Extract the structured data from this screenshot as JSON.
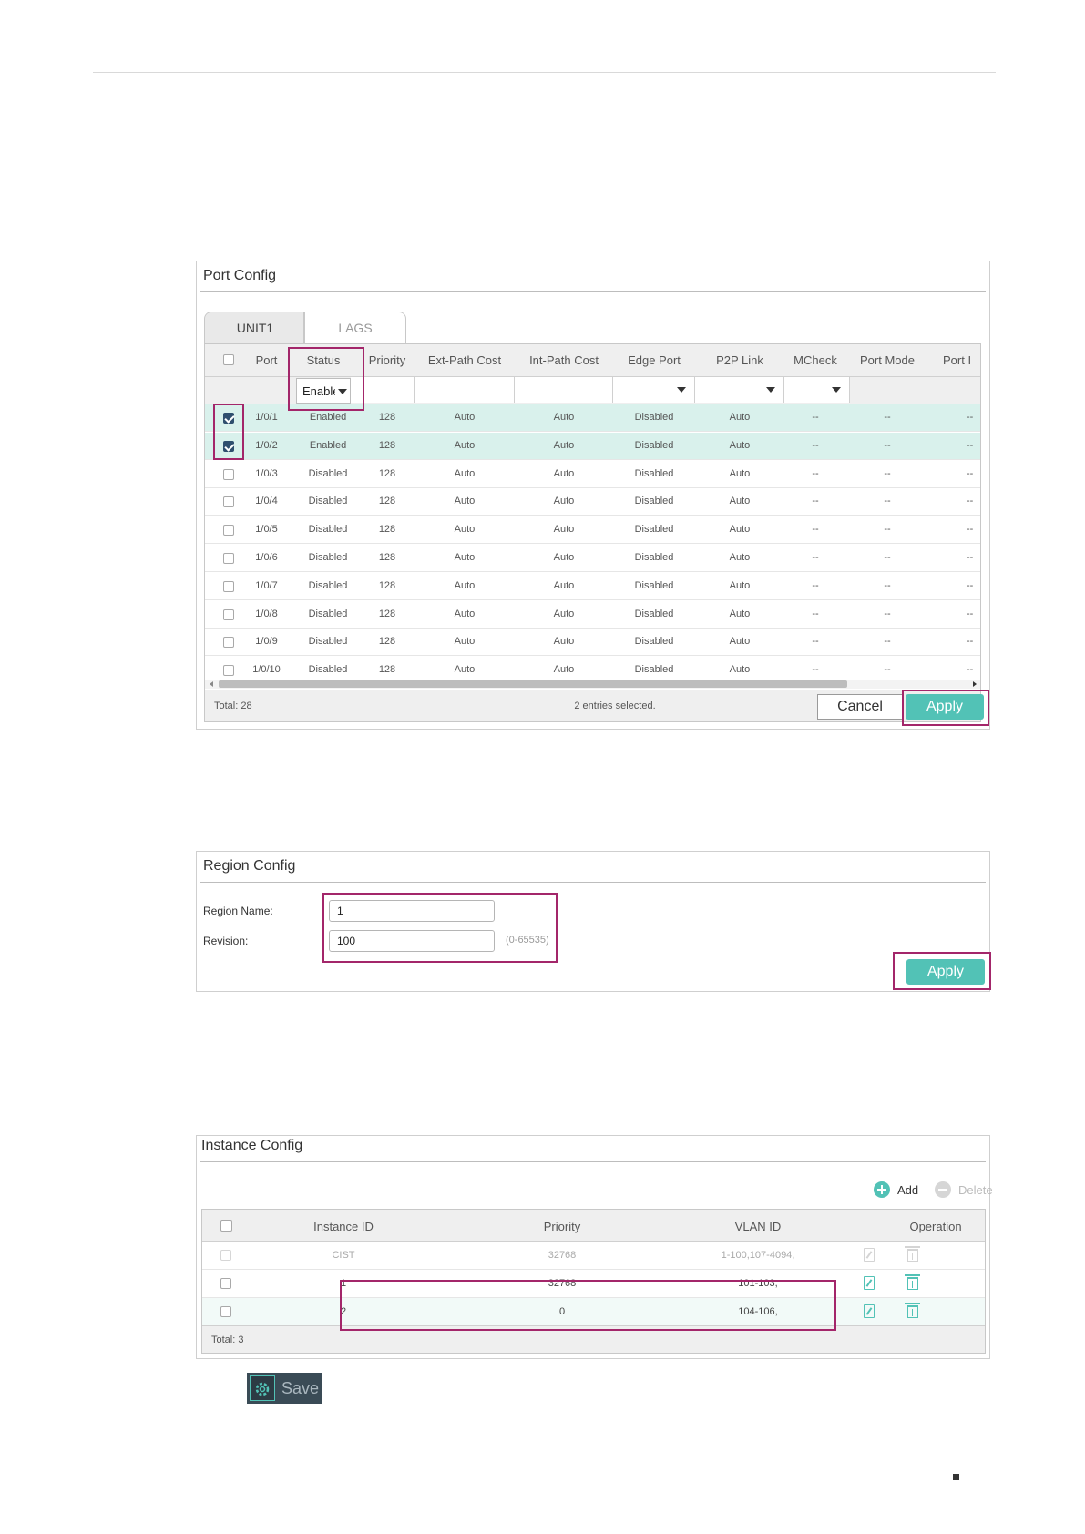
{
  "port_config": {
    "title": "Port Config",
    "tabs": [
      {
        "label": "UNIT1"
      },
      {
        "label": "LAGS"
      }
    ],
    "columns": [
      "Port",
      "Status",
      "Priority",
      "Ext-Path Cost",
      "Int-Path Cost",
      "Edge Port",
      "P2P Link",
      "MCheck",
      "Port Mode",
      "Port I"
    ],
    "filter_status_value": "Enable",
    "rows": [
      {
        "port": "1/0/1",
        "status": "Enabled",
        "priority": "128",
        "ext": "Auto",
        "int": "Auto",
        "edge": "Disabled",
        "p2p": "Auto",
        "mcheck": "--",
        "mode": "--",
        "role": "--",
        "checked": true
      },
      {
        "port": "1/0/2",
        "status": "Enabled",
        "priority": "128",
        "ext": "Auto",
        "int": "Auto",
        "edge": "Disabled",
        "p2p": "Auto",
        "mcheck": "--",
        "mode": "--",
        "role": "--",
        "checked": true
      },
      {
        "port": "1/0/3",
        "status": "Disabled",
        "priority": "128",
        "ext": "Auto",
        "int": "Auto",
        "edge": "Disabled",
        "p2p": "Auto",
        "mcheck": "--",
        "mode": "--",
        "role": "--",
        "checked": false
      },
      {
        "port": "1/0/4",
        "status": "Disabled",
        "priority": "128",
        "ext": "Auto",
        "int": "Auto",
        "edge": "Disabled",
        "p2p": "Auto",
        "mcheck": "--",
        "mode": "--",
        "role": "--",
        "checked": false
      },
      {
        "port": "1/0/5",
        "status": "Disabled",
        "priority": "128",
        "ext": "Auto",
        "int": "Auto",
        "edge": "Disabled",
        "p2p": "Auto",
        "mcheck": "--",
        "mode": "--",
        "role": "--",
        "checked": false
      },
      {
        "port": "1/0/6",
        "status": "Disabled",
        "priority": "128",
        "ext": "Auto",
        "int": "Auto",
        "edge": "Disabled",
        "p2p": "Auto",
        "mcheck": "--",
        "mode": "--",
        "role": "--",
        "checked": false
      },
      {
        "port": "1/0/7",
        "status": "Disabled",
        "priority": "128",
        "ext": "Auto",
        "int": "Auto",
        "edge": "Disabled",
        "p2p": "Auto",
        "mcheck": "--",
        "mode": "--",
        "role": "--",
        "checked": false
      },
      {
        "port": "1/0/8",
        "status": "Disabled",
        "priority": "128",
        "ext": "Auto",
        "int": "Auto",
        "edge": "Disabled",
        "p2p": "Auto",
        "mcheck": "--",
        "mode": "--",
        "role": "--",
        "checked": false
      },
      {
        "port": "1/0/9",
        "status": "Disabled",
        "priority": "128",
        "ext": "Auto",
        "int": "Auto",
        "edge": "Disabled",
        "p2p": "Auto",
        "mcheck": "--",
        "mode": "--",
        "role": "--",
        "checked": false
      },
      {
        "port": "1/0/10",
        "status": "Disabled",
        "priority": "128",
        "ext": "Auto",
        "int": "Auto",
        "edge": "Disabled",
        "p2p": "Auto",
        "mcheck": "--",
        "mode": "--",
        "role": "--",
        "checked": false
      }
    ],
    "total": "Total: 28",
    "selected": "2 entries selected.",
    "cancel_label": "Cancel",
    "apply_label": "Apply"
  },
  "region_config": {
    "title": "Region Config",
    "region_name_label": "Region Name:",
    "region_name_value": "1",
    "revision_label": "Revision:",
    "revision_value": "100",
    "revision_hint": "(0-65535)",
    "apply_label": "Apply"
  },
  "instance_config": {
    "title": "Instance Config",
    "add_label": "Add",
    "delete_label": "Delete",
    "columns": [
      "Instance ID",
      "Priority",
      "VLAN ID",
      "Operation"
    ],
    "rows": [
      {
        "id": "CIST",
        "priority": "32768",
        "vlan": "1-100,107-4094,",
        "dim": true
      },
      {
        "id": "1",
        "priority": "32768",
        "vlan": "101-103,",
        "dim": false
      },
      {
        "id": "2",
        "priority": "0",
        "vlan": "104-106,",
        "dim": false
      }
    ],
    "total": "Total: 3"
  },
  "save_button": {
    "label": "Save"
  },
  "colors": {
    "accent": "#52c2b6",
    "highlight": "#a3266a",
    "selected_row": "#d9f1ec"
  }
}
